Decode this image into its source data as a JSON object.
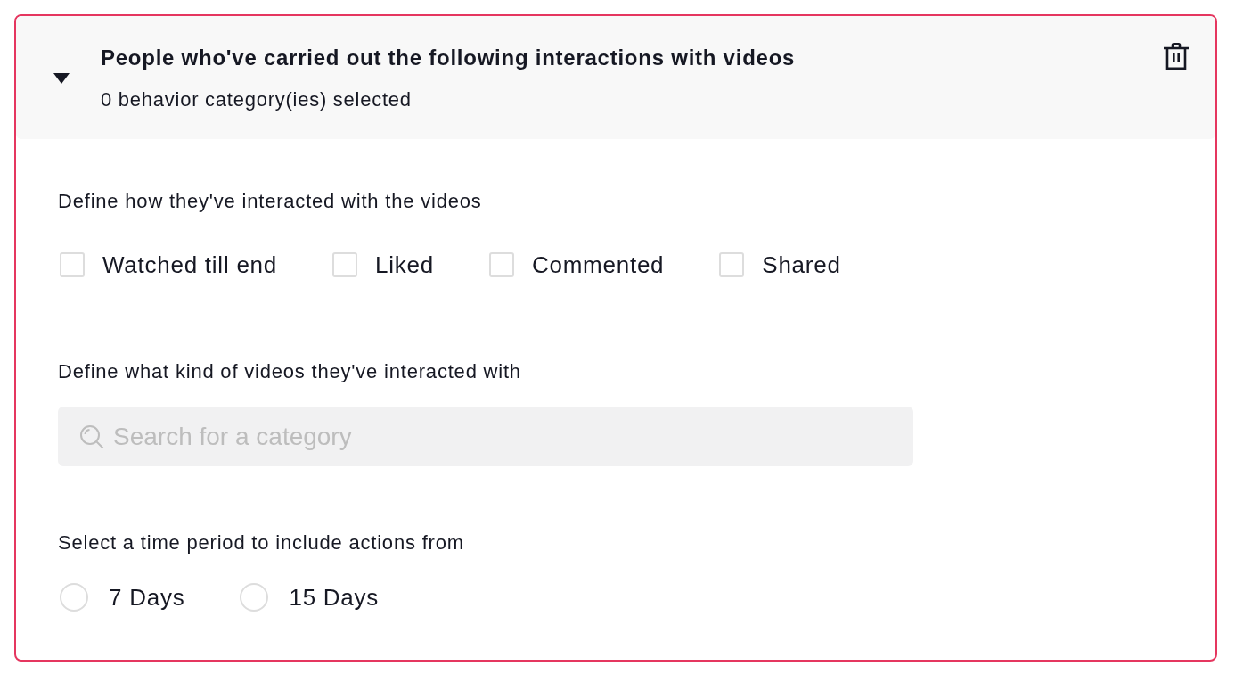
{
  "criterion": {
    "title": "People who've carried out the following interactions with videos",
    "subtitle": "0 behavior category(ies) selected",
    "expanded": true
  },
  "interaction_section": {
    "label": "Define how they've interacted with the videos",
    "options": [
      {
        "label": "Watched till end",
        "checked": false
      },
      {
        "label": "Liked",
        "checked": false
      },
      {
        "label": "Commented",
        "checked": false
      },
      {
        "label": "Shared",
        "checked": false
      }
    ]
  },
  "category_section": {
    "label": "Define what kind of videos they've interacted with",
    "search": {
      "placeholder": "Search for a category"
    }
  },
  "time_period_section": {
    "label": "Select a time period to include actions from",
    "options": [
      {
        "label": "7 Days",
        "selected": false
      },
      {
        "label": "15 Days",
        "selected": false
      }
    ]
  }
}
